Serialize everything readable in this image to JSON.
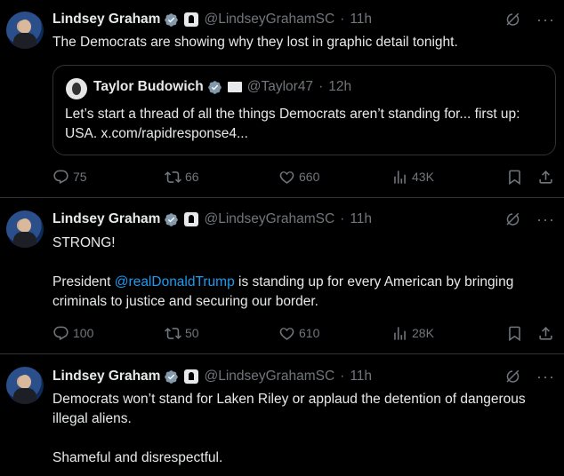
{
  "tweets": [
    {
      "name": "Lindsey Graham",
      "handle": "@LindseyGrahamSC",
      "time": "11h",
      "text": "The Democrats are showing why they lost in graphic detail tonight.",
      "quote": {
        "name": "Taylor Budowich",
        "handle": "@Taylor47",
        "time": "12h",
        "text": "Let’s start a thread of all the things Democrats aren’t standing for... first up: USA. x.com/rapidresponse4..."
      },
      "replies": "75",
      "reposts": "66",
      "likes": "660",
      "views": "43K"
    },
    {
      "name": "Lindsey Graham",
      "handle": "@LindseyGrahamSC",
      "time": "11h",
      "text_line1": "STRONG!",
      "text_pre": "President ",
      "mention": "@realDonaldTrump",
      "text_post": " is standing up for every American by bringing criminals to justice and securing our border.",
      "replies": "100",
      "reposts": "50",
      "likes": "610",
      "views": "28K"
    },
    {
      "name": "Lindsey Graham",
      "handle": "@LindseyGrahamSC",
      "time": "11h",
      "text": "Democrats won’t stand for Laken Riley or applaud the detention of dangerous illegal aliens.\n\nShameful and disrespectful."
    }
  ],
  "icons": [
    "grok-icon",
    "more-icon",
    "reply-icon",
    "repost-icon",
    "like-icon",
    "views-icon",
    "bookmark-icon",
    "share-icon",
    "verified-icon",
    "government-badge-icon"
  ]
}
